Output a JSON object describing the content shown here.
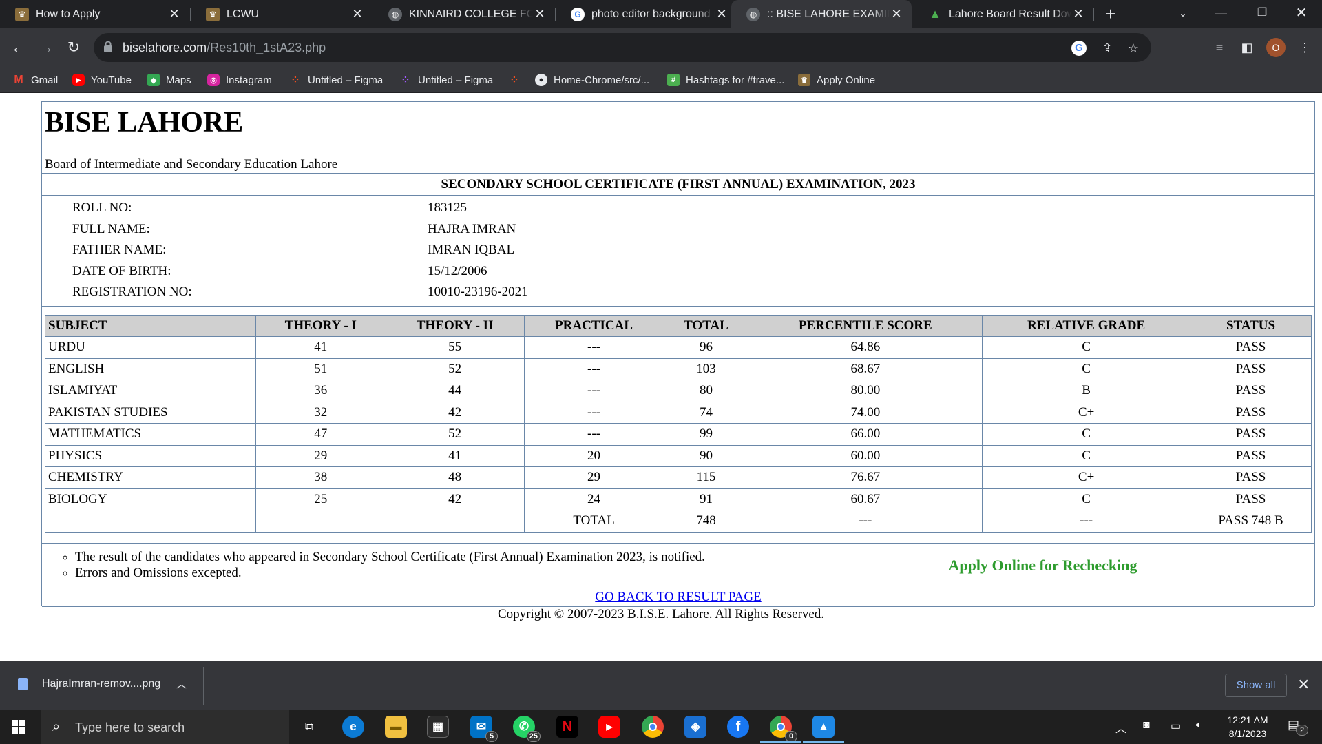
{
  "browser": {
    "tabs": [
      {
        "title": "How to Apply",
        "icon": "crest-icon"
      },
      {
        "title": "LCWU",
        "icon": "crest-icon"
      },
      {
        "title": "KINNAIRD COLLEGE FOR W",
        "icon": "globe-icon"
      },
      {
        "title": "photo editor background re",
        "icon": "google-icon"
      },
      {
        "title": ":: BISE LAHORE EXAMINATI",
        "icon": "globe-icon",
        "active": true
      },
      {
        "title": "Lahore Board Result Downl",
        "icon": "leaf-icon"
      }
    ],
    "url_host": "biselahore.com",
    "url_path": "/Res10th_1stA23.php",
    "profile_initial": "O",
    "bookmarks": [
      {
        "label": "Gmail",
        "icon": "gmail-icon"
      },
      {
        "label": "YouTube",
        "icon": "youtube-icon"
      },
      {
        "label": "Maps",
        "icon": "maps-icon"
      },
      {
        "label": "Instagram",
        "icon": "instagram-icon"
      },
      {
        "label": "Untitled – Figma",
        "icon": "figma-icon"
      },
      {
        "label": "Untitled – Figma",
        "icon": "figma-icon"
      },
      {
        "label": "",
        "icon": "figma-icon"
      },
      {
        "label": "Home-Chrome/src/...",
        "icon": "github-icon"
      },
      {
        "label": "Hashtags for #trave...",
        "icon": "hashtag-icon"
      },
      {
        "label": "Apply Online",
        "icon": "crest-icon"
      }
    ]
  },
  "page": {
    "board_title": "BISE LAHORE",
    "board_subtitle": "Board of Intermediate and Secondary Education Lahore",
    "exam_title": "SECONDARY SCHOOL CERTIFICATE (FIRST ANNUAL) EXAMINATION, 2023",
    "student": {
      "roll_no_label": "ROLL NO:",
      "roll_no": "183125",
      "full_name_label": "FULL NAME:",
      "full_name": "HAJRA IMRAN",
      "father_name_label": "FATHER NAME:",
      "father_name": "IMRAN IQBAL",
      "dob_label": "DATE OF BIRTH:",
      "dob": "15/12/2006",
      "reg_no_label": "REGISTRATION NO:",
      "reg_no": "10010-23196-2021"
    },
    "table_headers": [
      "SUBJECT",
      "THEORY - I",
      "THEORY - II",
      "PRACTICAL",
      "TOTAL",
      "PERCENTILE SCORE",
      "RELATIVE GRADE",
      "STATUS"
    ],
    "rows": [
      [
        "URDU",
        "41",
        "55",
        "---",
        "96",
        "64.86",
        "C",
        "PASS"
      ],
      [
        "ENGLISH",
        "51",
        "52",
        "---",
        "103",
        "68.67",
        "C",
        "PASS"
      ],
      [
        "ISLAMIYAT",
        "36",
        "44",
        "---",
        "80",
        "80.00",
        "B",
        "PASS"
      ],
      [
        "PAKISTAN STUDIES",
        "32",
        "42",
        "---",
        "74",
        "74.00",
        "C+",
        "PASS"
      ],
      [
        "MATHEMATICS",
        "47",
        "52",
        "---",
        "99",
        "66.00",
        "C",
        "PASS"
      ],
      [
        "PHYSICS",
        "29",
        "41",
        "20",
        "90",
        "60.00",
        "C",
        "PASS"
      ],
      [
        "CHEMISTRY",
        "38",
        "48",
        "29",
        "115",
        "76.67",
        "C+",
        "PASS"
      ],
      [
        "BIOLOGY",
        "25",
        "42",
        "24",
        "91",
        "60.67",
        "C",
        "PASS"
      ]
    ],
    "total_row": [
      "",
      "",
      "",
      "TOTAL",
      "748",
      "---",
      "---",
      "PASS 748 B"
    ],
    "notes": [
      "The result of the candidates who appeared in Secondary School Certificate (First Annual) Examination 2023, is notified.",
      "Errors and Omissions excepted."
    ],
    "recheck_link": "Apply Online for Rechecking",
    "back_link": "GO BACK TO RESULT PAGE",
    "copyright_prefix": "Copyright © 2007-2023 ",
    "copyright_link": "B.I.S.E. Lahore.",
    "copyright_suffix": " All Rights Reserved."
  },
  "downloads": {
    "file_name": "HajraImran-remov....png",
    "show_all": "Show all"
  },
  "taskbar": {
    "search_placeholder": "Type here to search",
    "mail_badge": "5",
    "whatsapp_badge": "25",
    "chrome_badge": "0",
    "time": "12:21 AM",
    "date": "8/1/2023",
    "notification_count": "2"
  },
  "colors": {
    "chrome_dark": "#202124",
    "chrome_toolbar": "#35363a",
    "table_border": "#6a87a8",
    "table_header_bg": "#d0d0d0",
    "recheck_green": "#2e9c2e",
    "link_blue": "#0000ee",
    "taskbar_bg": "#1f1f1f"
  }
}
